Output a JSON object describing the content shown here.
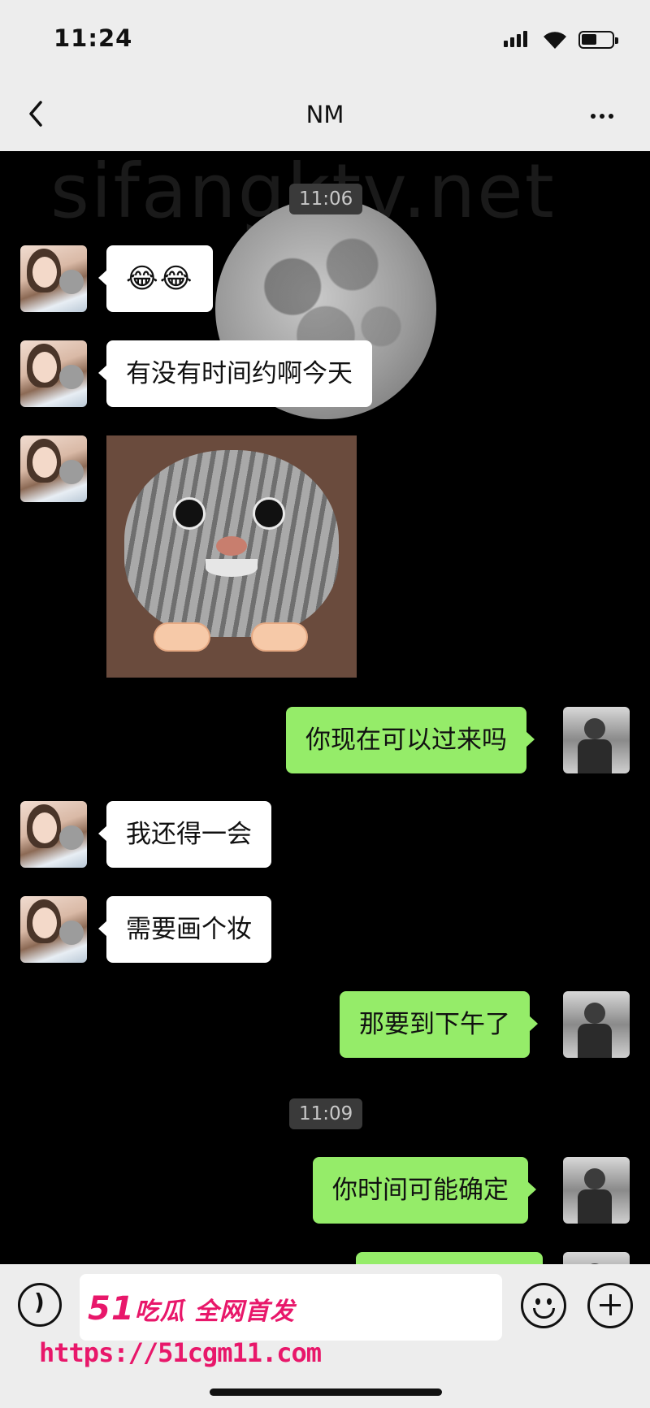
{
  "status_bar": {
    "time": "11:24"
  },
  "nav": {
    "title": "NM"
  },
  "chat": {
    "watermark": "sifangktv.net",
    "timestamps": [
      "11:06",
      "11:09"
    ],
    "messages": [
      {
        "side": "in",
        "text": "😂😂"
      },
      {
        "side": "in",
        "text": "有没有时间约啊今天"
      },
      {
        "side": "in",
        "type": "image",
        "text": ""
      },
      {
        "side": "out",
        "text": "你现在可以过来吗"
      },
      {
        "side": "in",
        "text": "我还得一会"
      },
      {
        "side": "in",
        "text": "需要画个妆"
      },
      {
        "side": "out",
        "text": "那要到下午了"
      },
      {
        "side": "out",
        "text": "你时间可能确定"
      }
    ]
  },
  "overlay": {
    "brand_num": "51",
    "brand_text": "吃瓜 全网首发",
    "url": "https://51cgm11.com"
  },
  "colors": {
    "out_bubble": "#95ec69",
    "in_bubble": "#ffffff",
    "watermark": "#e8176a"
  }
}
